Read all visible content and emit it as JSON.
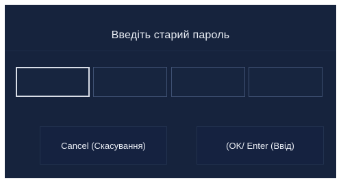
{
  "dialog": {
    "title": "Введіть старий пароль",
    "pin_boxes": [
      "",
      "",
      "",
      ""
    ],
    "active_box_index": 0,
    "cancel_label": "Cancel (Скасування)",
    "ok_label": "(OK/ Enter (Ввід)"
  },
  "colors": {
    "background": "#16233d",
    "box_border": "#3f5173",
    "active_border": "#d9dee8",
    "text": "#e8ecf3"
  }
}
